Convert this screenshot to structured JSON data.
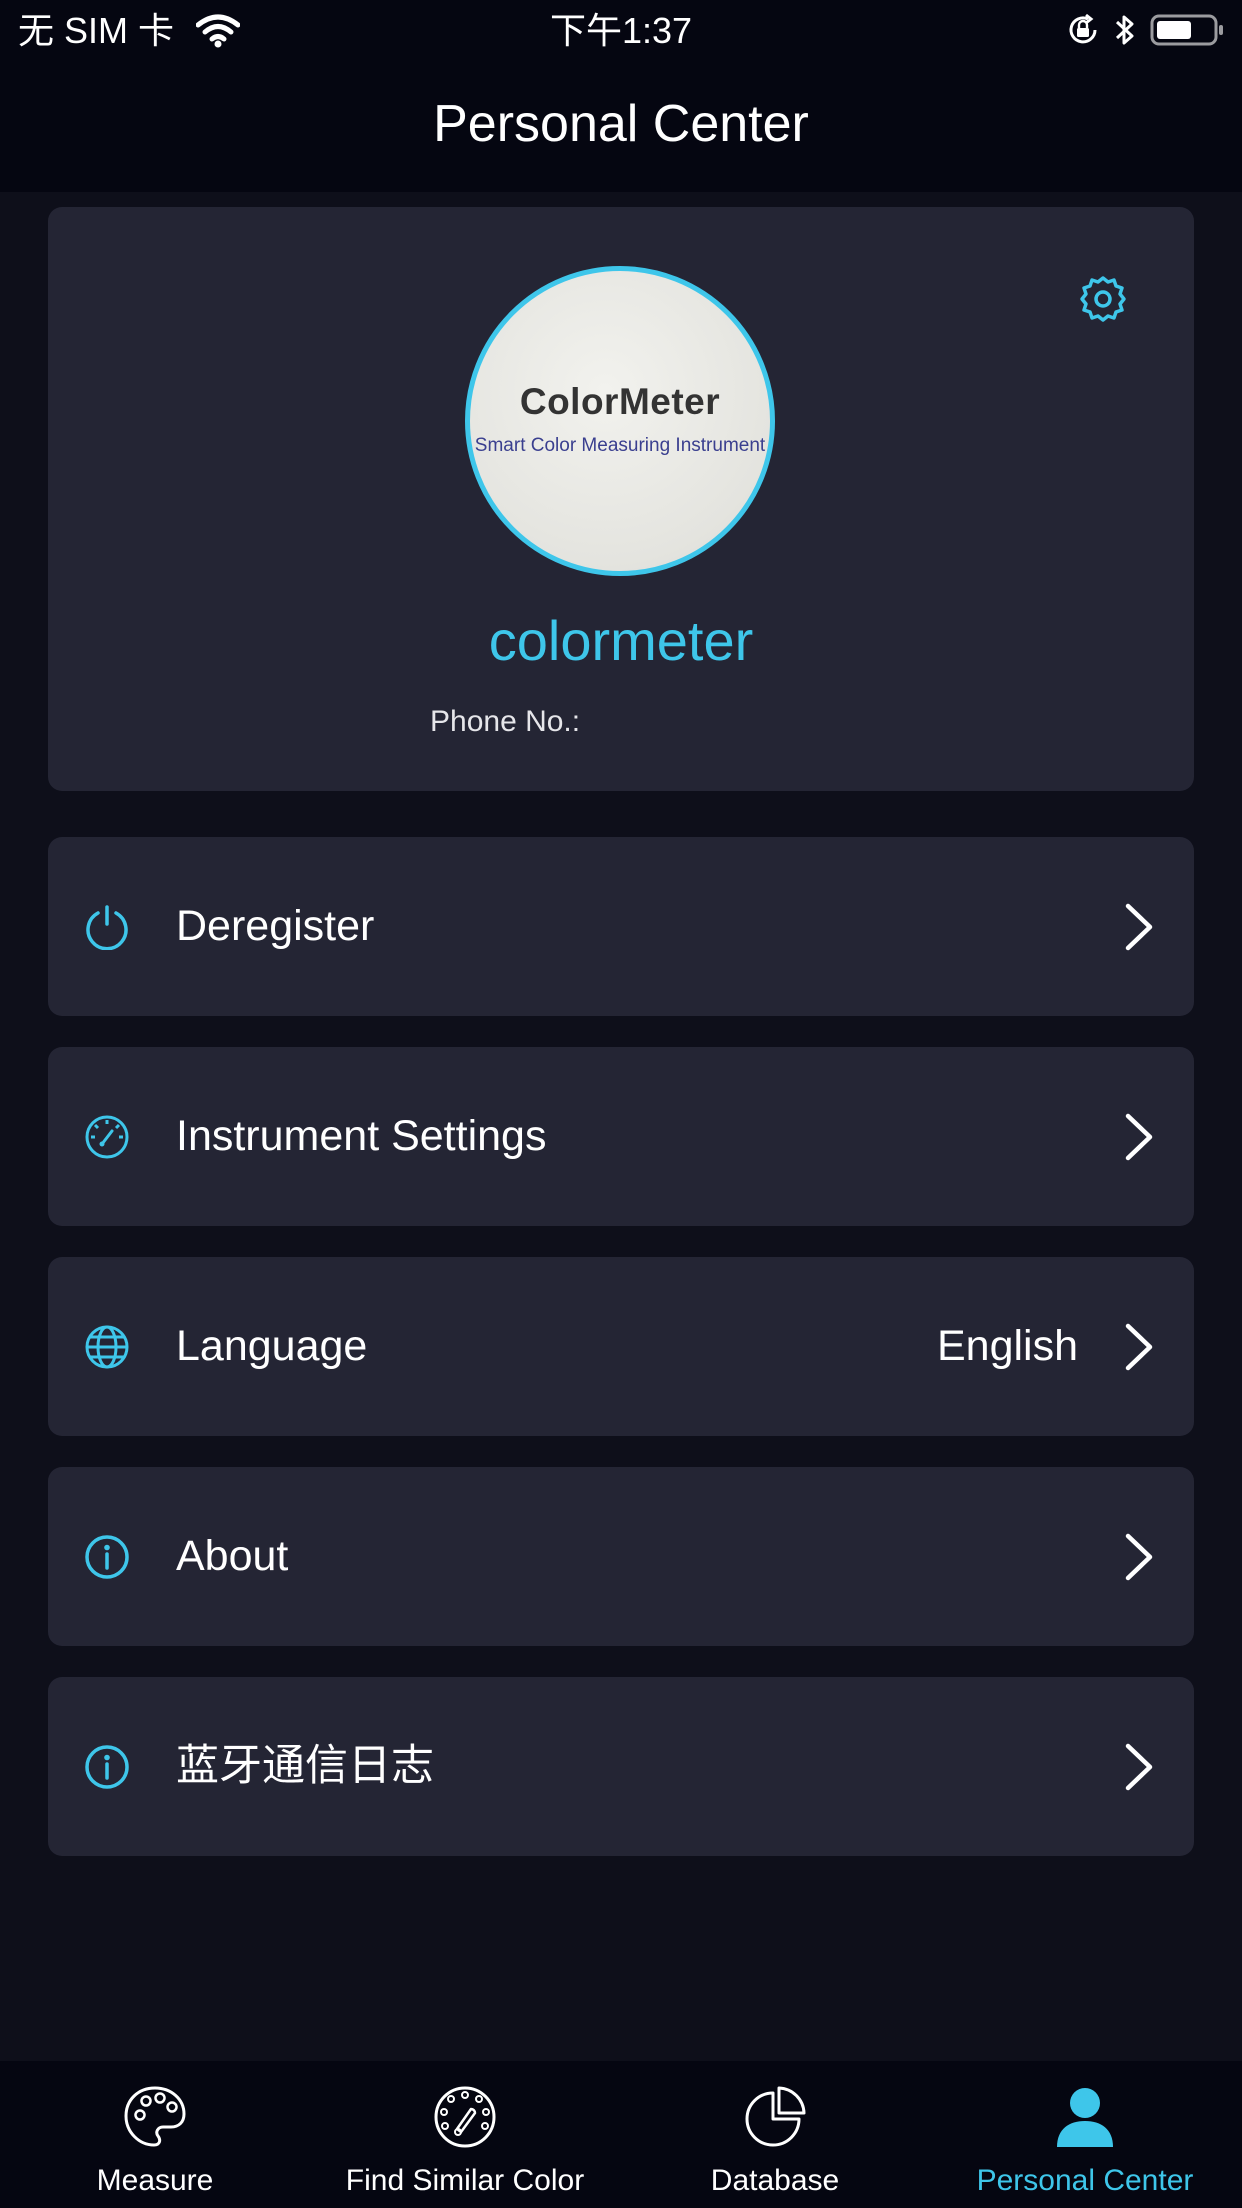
{
  "status_bar": {
    "carrier": "无 SIM 卡",
    "time": "下午1:37"
  },
  "header": {
    "title": "Personal Center"
  },
  "profile": {
    "avatar_title": "ColorMeter",
    "avatar_subtitle": "Smart Color Measuring Instrument",
    "username": "colormeter",
    "phone_label": "Phone No.:"
  },
  "menu": {
    "items": [
      {
        "label": "Deregister",
        "icon": "power-icon"
      },
      {
        "label": "Instrument Settings",
        "icon": "gauge-icon"
      },
      {
        "label": "Language",
        "value": "English",
        "icon": "globe-icon"
      },
      {
        "label": "About",
        "icon": "info-icon"
      },
      {
        "label": "蓝牙通信日志",
        "icon": "info-icon"
      }
    ]
  },
  "tabs": [
    {
      "label": "Measure",
      "icon": "palette-icon",
      "active": false
    },
    {
      "label": "Find Similar Color",
      "icon": "dial-icon",
      "active": false
    },
    {
      "label": "Database",
      "icon": "pie-chart-icon",
      "active": false
    },
    {
      "label": "Personal Center",
      "icon": "person-icon",
      "active": true
    }
  ],
  "colors": {
    "accent": "#3ec6ea",
    "background": "#0e0f1a",
    "card": "#242534",
    "bar": "#050611"
  }
}
